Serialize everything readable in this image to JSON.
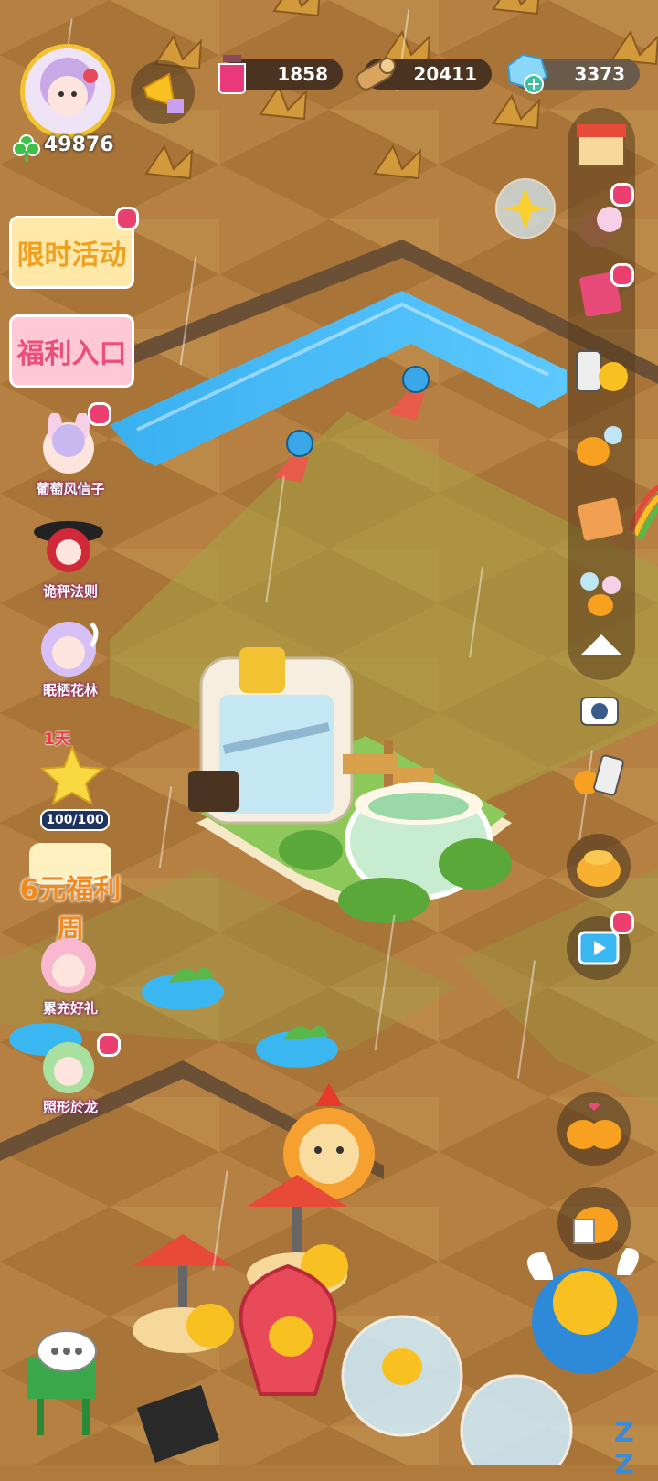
{
  "resources": {
    "potion": "1858",
    "wood": "20411",
    "gem": "3373",
    "clover": "49876"
  },
  "left_menu": {
    "event_label": "限时活动",
    "welfare_label": "福利入口",
    "items": [
      {
        "label": "葡萄风信子"
      },
      {
        "label": "诡秤法则"
      },
      {
        "label": "眠栖花林"
      },
      {
        "label": "6元福利周"
      },
      {
        "label": "累充好礼"
      },
      {
        "label": "照形於龙"
      }
    ],
    "star_timer": "1天",
    "star_progress": "100/100"
  },
  "icons": {
    "megaphone": "megaphone-icon",
    "potion": "potion-icon",
    "wood": "wood-icon",
    "gem": "gem-icon",
    "clover": "clover-icon"
  },
  "colors": {
    "ground": "#b07a3c",
    "water": "#3ab6f0",
    "accent_pink": "#ea3f6f",
    "gold": "#f2c232"
  },
  "sleep_text": "Z Z"
}
